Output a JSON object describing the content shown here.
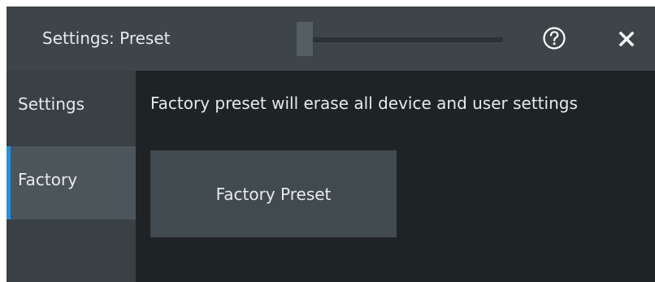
{
  "dialog": {
    "title": "Settings: Preset",
    "help_icon": "help-circle-icon",
    "close_icon": "close-icon"
  },
  "sidebar": {
    "tabs": [
      {
        "label": "Settings",
        "selected": false
      },
      {
        "label": "Factory",
        "selected": true
      }
    ]
  },
  "content": {
    "message": "Factory preset will erase all device and user settings",
    "button_label": "Factory Preset"
  },
  "colors": {
    "accent": "#1f92e0",
    "titlebar": "#3d4549",
    "content_bg": "#1e2325",
    "sidebar_bg": "#394145",
    "selected_tab": "#4b555a",
    "button_bg": "#414a4f",
    "text": "#e7eaec"
  }
}
